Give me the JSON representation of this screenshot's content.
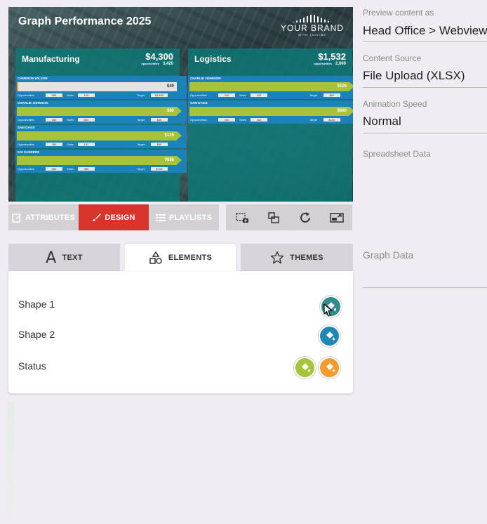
{
  "preview": {
    "title": "Graph Performance 2025",
    "brand_name": "YOUR BRAND",
    "brand_tagline": "WITH TAGLINE",
    "columns": [
      {
        "name": "Manufacturing",
        "total": "$4,300",
        "opportunities_label": "opportunities",
        "opportunities": "3,420",
        "rows": [
          {
            "name": "CAMERON WILSON",
            "value": "$40",
            "progress": 0.01,
            "opportunities": "380",
            "sales": "125",
            "target": "$3,450"
          },
          {
            "name": "CHARLIE JOHNSON",
            "value": "$80",
            "progress": 1.0,
            "opportunities": "280",
            "sales": "600",
            "target": "$40"
          },
          {
            "name": "SAM DAVIS",
            "value": "$125",
            "progress": 1.0,
            "opportunities": "380",
            "sales": "102",
            "target": "$50"
          },
          {
            "name": "KAI SANDERS",
            "value": "$680",
            "progress": 1.0,
            "opportunities": "380",
            "sales": "380",
            "target": "$725"
          }
        ]
      },
      {
        "name": "Logistics",
        "total": "$1,532",
        "opportunities_label": "opportunities",
        "opportunities": "2,660",
        "rows": [
          {
            "name": "CHARLIE JOHNSON",
            "value": "$125",
            "progress": 1.0,
            "opportunities": "310",
            "sales": "102",
            "target": "$50"
          },
          {
            "name": "SAM DAVIS",
            "value": "$680",
            "progress": 1.0,
            "opportunities": "310",
            "sales": "102",
            "target": "$125"
          }
        ]
      }
    ],
    "stat_labels": {
      "opportunities": "Opportunities",
      "sales": "Sales",
      "target": "Target"
    }
  },
  "toolbar": {
    "attributes": "ATTRIBUTES",
    "design": "DESIGN",
    "playlists": "PLAYLISTS",
    "tools": [
      "screenshot-icon",
      "copy-icon",
      "refresh-icon",
      "resize-icon"
    ]
  },
  "tabs": {
    "text": "TEXT",
    "elements": "ELEMENTS",
    "themes": "THEMES"
  },
  "elements": [
    {
      "label": "Shape 1",
      "colors": [
        "#2e8c8a"
      ]
    },
    {
      "label": "Shape 2",
      "colors": [
        "#1f88b6"
      ]
    },
    {
      "label": "Status",
      "colors": [
        "#a6c437",
        "#f39b2d"
      ]
    }
  ],
  "fields": {
    "preview_label": "Preview content as",
    "preview_value": "Head Office > Webview",
    "source_label": "Content Source",
    "source_value": "File Upload (XLSX)",
    "speed_label": "Animation Speed",
    "speed_value": "Normal",
    "spreadsheet_label": "Spreadsheet Data",
    "graph_label": "Graph Data"
  },
  "colors": {
    "accent": "#d9342b",
    "teal": "#0b7976",
    "row_blue": "#1a82b8",
    "bar_green": "#a6c437"
  }
}
